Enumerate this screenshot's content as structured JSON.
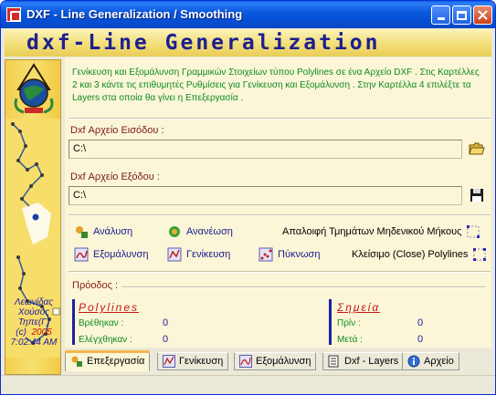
{
  "window": {
    "title": "DXF - Line Generalization / Smoothing"
  },
  "banner": {
    "text": "dxf-Line Generalization"
  },
  "left_strip": {
    "author_line1": "Λεωνίδας",
    "author_line2": "Χούσος",
    "author_line3": "Τηπε(Γ)",
    "copyright": "(c)",
    "year": "2005",
    "time": "7:02:44 AM"
  },
  "description": "Γενίκευση και Εξομάλυνση Γραμμικών Στοιχείων τύπου Polylines σε ένα Αρχείο DXF . Στις Καρτέλλες 2 και 3 κάντε τις επιθυμητές Ρυθμίσεις για Γενίκευση και Εξομάλυνση . Στην Καρτέλλα 4 επιλέξτε τα Layers στα οποία θα γίνει η Επεξεργασία .",
  "input_file": {
    "label": "Dxf Αρχείο Εισόδου :",
    "value": "C:\\"
  },
  "output_file": {
    "label": "Dxf Αρχείο Εξόδου :",
    "value": "C:\\"
  },
  "actions": {
    "analysis": "Ανάλυση",
    "refresh": "Ανανέωση",
    "remove_zero": "Απαλοιφή Τμημάτων Μηδενικού Μήκους",
    "smoothing": "Εξομάλυνση",
    "generalization": "Γενίκευση",
    "densify": "Πύκνωση",
    "close_polylines": "Κλείσιμο (Close) Polylines"
  },
  "progress": {
    "label": "Πρόοδος :"
  },
  "stats": {
    "polylines": {
      "title": "Polylines",
      "found_label": "Βρέθηκαν :",
      "found_value": "0",
      "checked_label": "Ελέγχθηκαν :",
      "checked_value": "0"
    },
    "points": {
      "title": "Σημεία",
      "before_label": "Πρίν :",
      "before_value": "0",
      "after_label": "Μετά :",
      "after_value": "0"
    }
  },
  "tabs": [
    {
      "label": "Επεξεργασία",
      "icon": "process-icon",
      "active": true
    },
    {
      "label": "Γενίκευση",
      "icon": "generalize-icon",
      "active": false
    },
    {
      "label": "Εξομάλυνση",
      "icon": "smooth-icon",
      "active": false
    },
    {
      "label": "Dxf - Layers",
      "icon": "layers-icon",
      "active": false
    },
    {
      "label": "Αρχείο",
      "icon": "info-icon",
      "active": false
    }
  ],
  "colors": {
    "title_bar": "#0b5ae0",
    "description_text": "#0f8a24",
    "group_title": "#c41818",
    "value_text": "#1f1fa0"
  }
}
